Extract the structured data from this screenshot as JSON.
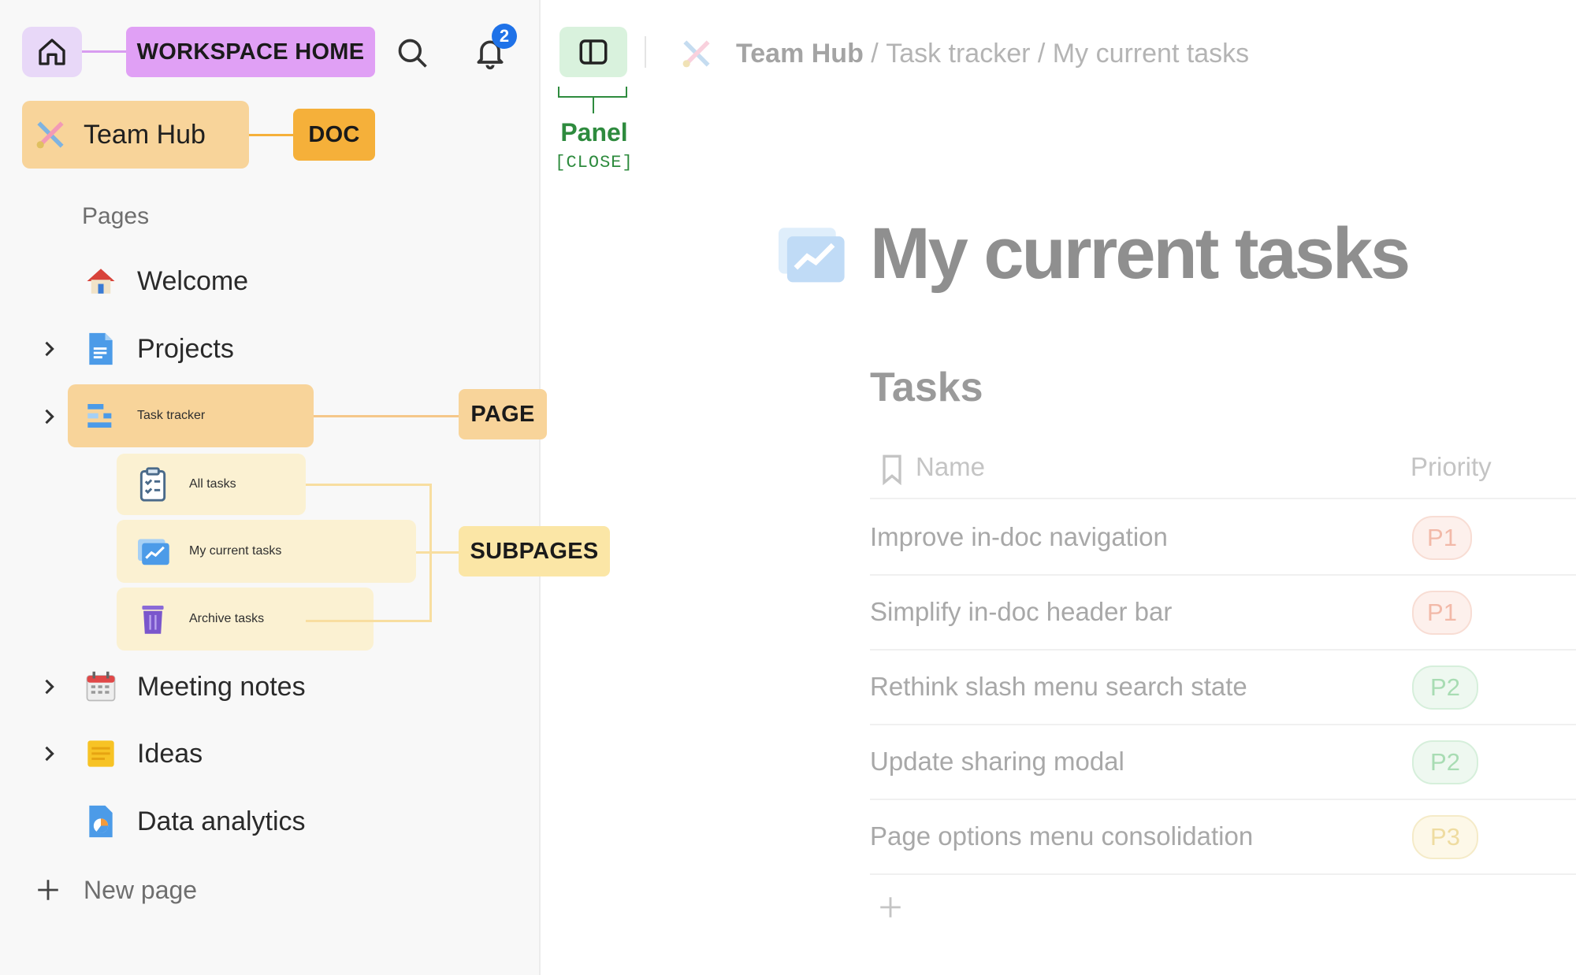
{
  "sidebar": {
    "notification_count": "2",
    "doc": {
      "title": "Team Hub"
    },
    "section_label": "Pages",
    "pages": [
      {
        "label": "Welcome"
      },
      {
        "label": "Projects"
      },
      {
        "label": "Task tracker"
      },
      {
        "label": "All tasks"
      },
      {
        "label": "My current tasks"
      },
      {
        "label": "Archive tasks"
      },
      {
        "label": "Meeting notes"
      },
      {
        "label": "Ideas"
      },
      {
        "label": "Data analytics"
      }
    ],
    "new_page": "New page"
  },
  "annotations": {
    "workspace_home": "WORKSPACE HOME",
    "doc": "DOC",
    "page": "PAGE",
    "subpages": "SUBPAGES",
    "panel": "Panel",
    "panel_sub": "[CLOSE]"
  },
  "breadcrumb": {
    "root": "Team Hub",
    "sep1": " / ",
    "parent": "Task tracker",
    "sep2": " / ",
    "current": "My current tasks"
  },
  "main": {
    "title": "My current tasks",
    "table_title": "Tasks",
    "columns": {
      "name": "Name",
      "priority": "Priority"
    },
    "rows": [
      {
        "name": "Improve in-doc navigation",
        "priority": "P1"
      },
      {
        "name": "Simplify in-doc header bar",
        "priority": "P1"
      },
      {
        "name": "Rethink slash menu search state",
        "priority": "P2"
      },
      {
        "name": "Update sharing modal",
        "priority": "P2"
      },
      {
        "name": "Page options menu consolidation",
        "priority": "P3"
      }
    ]
  },
  "colors": {
    "workspace_tag": "#e0a0f5",
    "doc_tag": "#f5b03a",
    "page_tag": "#f8d49a",
    "subpage_tag": "#fbe6a6",
    "panel_green": "#2e8b3e",
    "p1": "#f2b9a8",
    "p2": "#a8dcb3",
    "p3": "#efdca0"
  }
}
